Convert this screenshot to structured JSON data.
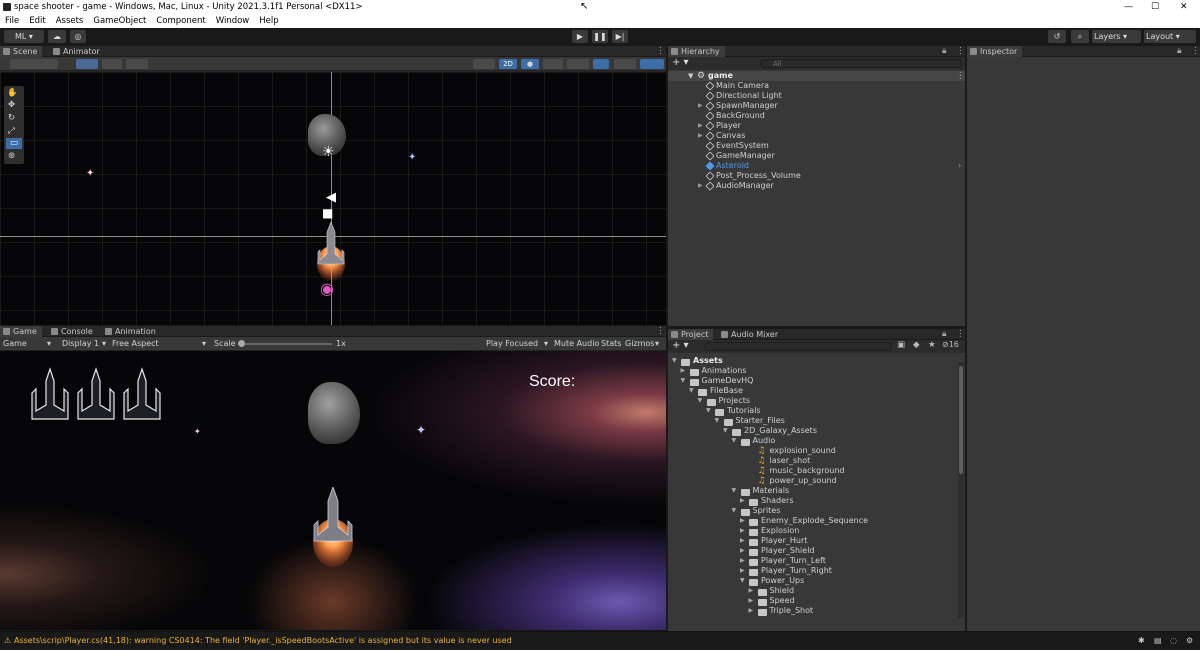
{
  "window": {
    "title": "space shooter - game - Windows, Mac, Linux - Unity 2021.3.1f1 Personal <DX11>",
    "minimize": "—",
    "maximize": "☐",
    "close": "✕"
  },
  "menu": [
    "File",
    "Edit",
    "Assets",
    "GameObject",
    "Component",
    "Window",
    "Help"
  ],
  "toolbar": {
    "account_label": "ML",
    "layers_label": "Layers",
    "layout_label": "Layout"
  },
  "scene_panel": {
    "tabs": [
      "Scene",
      "Animator"
    ],
    "mode_2d": "2D"
  },
  "game_panel": {
    "tabs": [
      "Game",
      "Console",
      "Animation"
    ],
    "display_mode": "Game",
    "display": "Display 1",
    "aspect": "Free Aspect",
    "scale_label": "Scale",
    "scale_value": "1x",
    "play_focused": "Play Focused",
    "mute_audio": "Mute Audio",
    "stats": "Stats",
    "gizmos": "Gizmos",
    "score_label": "Score:"
  },
  "hierarchy": {
    "tab": "Hierarchy",
    "search_placeholder": "All",
    "root": "game",
    "items": [
      "Main Camera",
      "Directional Light",
      "SpawnManager",
      "BackGround",
      "Player",
      "Canvas",
      "EventSystem",
      "GameManager",
      "Asteroid",
      "Post_Process_Volume",
      "AudioManager"
    ]
  },
  "inspector": {
    "tab": "Inspector"
  },
  "project": {
    "tabs": [
      "Project",
      "Audio Mixer"
    ],
    "badge": "16",
    "tree": [
      {
        "label": "Assets",
        "depth": 0,
        "type": "folder",
        "bold": true
      },
      {
        "label": "Animations",
        "depth": 1,
        "type": "folder"
      },
      {
        "label": "GameDevHQ",
        "depth": 1,
        "type": "folder"
      },
      {
        "label": "FileBase",
        "depth": 2,
        "type": "folder"
      },
      {
        "label": "Projects",
        "depth": 3,
        "type": "folder"
      },
      {
        "label": "Tutorials",
        "depth": 4,
        "type": "folder"
      },
      {
        "label": "Starter_Files",
        "depth": 5,
        "type": "folder"
      },
      {
        "label": "2D_Galaxy_Assets",
        "depth": 6,
        "type": "folder"
      },
      {
        "label": "Audio",
        "depth": 7,
        "type": "folder"
      },
      {
        "label": "explosion_sound",
        "depth": 9,
        "type": "audio"
      },
      {
        "label": "laser_shot",
        "depth": 9,
        "type": "audio"
      },
      {
        "label": "music_background",
        "depth": 9,
        "type": "audio"
      },
      {
        "label": "power_up_sound",
        "depth": 9,
        "type": "audio"
      },
      {
        "label": "Materials",
        "depth": 7,
        "type": "folder"
      },
      {
        "label": "Shaders",
        "depth": 8,
        "type": "folder"
      },
      {
        "label": "Sprites",
        "depth": 7,
        "type": "folder"
      },
      {
        "label": "Enemy_Explode_Sequence",
        "depth": 8,
        "type": "folder"
      },
      {
        "label": "Explosion",
        "depth": 8,
        "type": "folder"
      },
      {
        "label": "Player_Hurt",
        "depth": 8,
        "type": "folder"
      },
      {
        "label": "Player_Shield",
        "depth": 8,
        "type": "folder"
      },
      {
        "label": "Player_Turn_Left",
        "depth": 8,
        "type": "folder"
      },
      {
        "label": "Player_Turn_Right",
        "depth": 8,
        "type": "folder"
      },
      {
        "label": "Power_Ups",
        "depth": 8,
        "type": "folder"
      },
      {
        "label": "Shield",
        "depth": 9,
        "type": "folder"
      },
      {
        "label": "Speed",
        "depth": 9,
        "type": "folder"
      },
      {
        "label": "Triple_Shot",
        "depth": 9,
        "type": "folder"
      }
    ]
  },
  "status": {
    "message": "Assets\\scrip\\Player.cs(41,18): warning CS0414: The field 'Player._isSpeedBootsActive' is assigned but its value is never used"
  },
  "colors": {
    "selected_item": "#4c9ae8",
    "warning": "#e8b33d",
    "panel": "#383838"
  }
}
